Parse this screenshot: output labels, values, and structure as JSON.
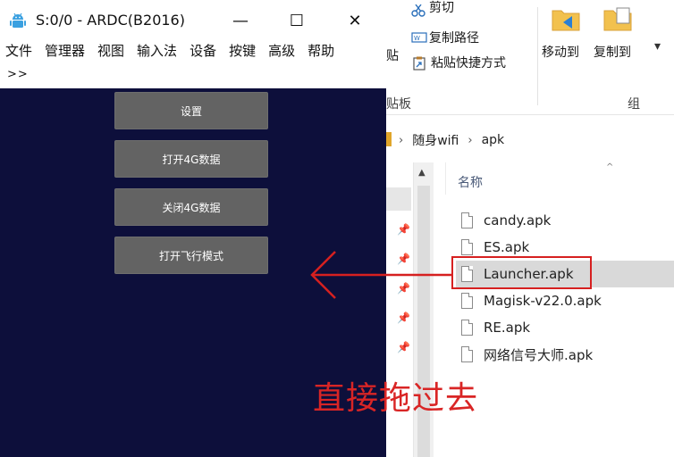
{
  "ardc": {
    "title": "S:0/0 - ARDC(B2016)",
    "window_controls": {
      "minimize": "—",
      "maximize": "☐",
      "close": "✕"
    },
    "menu": [
      "文件",
      "管理器",
      "视图",
      "输入法",
      "设备",
      "按键",
      "高级",
      "帮助"
    ],
    "overflow": ">>",
    "buttons": [
      "设置",
      "打开4G数据",
      "关闭4G数据",
      "打开飞行模式"
    ]
  },
  "explorer": {
    "ribbon": {
      "cut_partial": "剪切",
      "copy_path": "复制路径",
      "paste_shortcut": "粘贴快捷方式",
      "paste_partial": "贴",
      "clipboard_partial": "贴板",
      "move_to": "移动到",
      "copy_to": "复制到",
      "organize_partial": "组"
    },
    "breadcrumb": [
      "随身wifi",
      "apk"
    ],
    "breadcrumb_sep": "›",
    "column_header": "名称",
    "files": [
      {
        "name": "candy.apk",
        "selected": false
      },
      {
        "name": "ES.apk",
        "selected": false
      },
      {
        "name": "Launcher.apk",
        "selected": true
      },
      {
        "name": "Magisk-v22.0.apk",
        "selected": false
      },
      {
        "name": "RE.apk",
        "selected": false
      },
      {
        "name": "网络信号大师.apk",
        "selected": false
      }
    ]
  },
  "annotation": {
    "text": "直接拖过去",
    "color": "#d92525"
  },
  "colors": {
    "ardc_background": "#0d0f3b",
    "button_gray": "#636363",
    "highlight_red": "#d62020",
    "selected_row": "#d9d9d9"
  }
}
